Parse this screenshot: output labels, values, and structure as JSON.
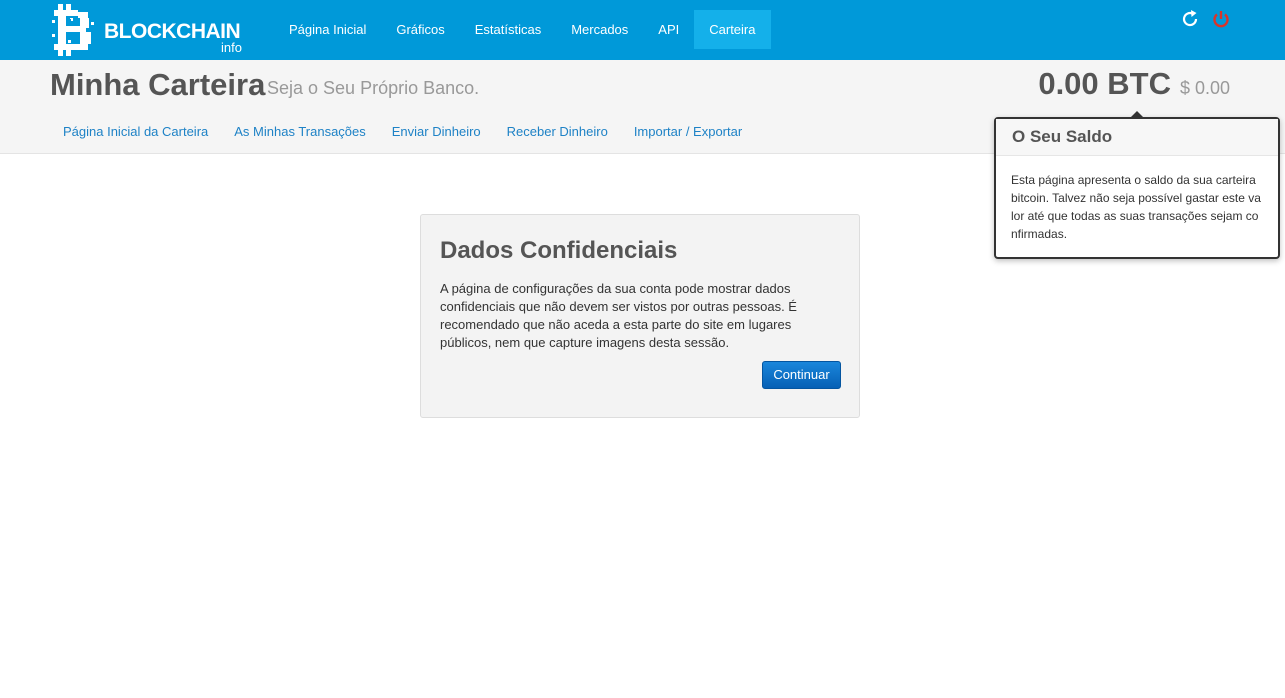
{
  "brand": {
    "name": "BLOCKCHAIN",
    "sub": "info",
    "color": "#0099d9"
  },
  "nav": {
    "items": [
      {
        "label": "Página Inicial"
      },
      {
        "label": "Gráficos"
      },
      {
        "label": "Estatísticas"
      },
      {
        "label": "Mercados"
      },
      {
        "label": "API"
      },
      {
        "label": "Carteira",
        "active": true
      }
    ],
    "icons": [
      "refresh-icon",
      "power-icon"
    ]
  },
  "header": {
    "title": "Minha Carteira",
    "subtitle": "Seja o Seu Próprio Banco.",
    "balance_btc": "0.00 BTC",
    "balance_usd": "$ 0.00"
  },
  "subnav": {
    "items": [
      {
        "label": "Página Inicial da Carteira"
      },
      {
        "label": "As Minhas Transações"
      },
      {
        "label": "Enviar Dinheiro"
      },
      {
        "label": "Receber Dinheiro"
      },
      {
        "label": "Importar / Exportar"
      }
    ]
  },
  "popover": {
    "title": "O Seu Saldo",
    "body": "Esta página apresenta o saldo da sua carteira bitcoin. Talvez não seja possível gastar este valor até que todas as suas transações sejam confirmadas."
  },
  "card": {
    "title": "Dados Confidenciais",
    "text": "A página de configurações da sua conta pode mostrar dados confidenciais que não devem ser vistos por outras pessoas. É recomendado que não aceda a esta parte do site em lugares públicos, nem que capture imagens desta sessão.",
    "button": "Continuar"
  }
}
